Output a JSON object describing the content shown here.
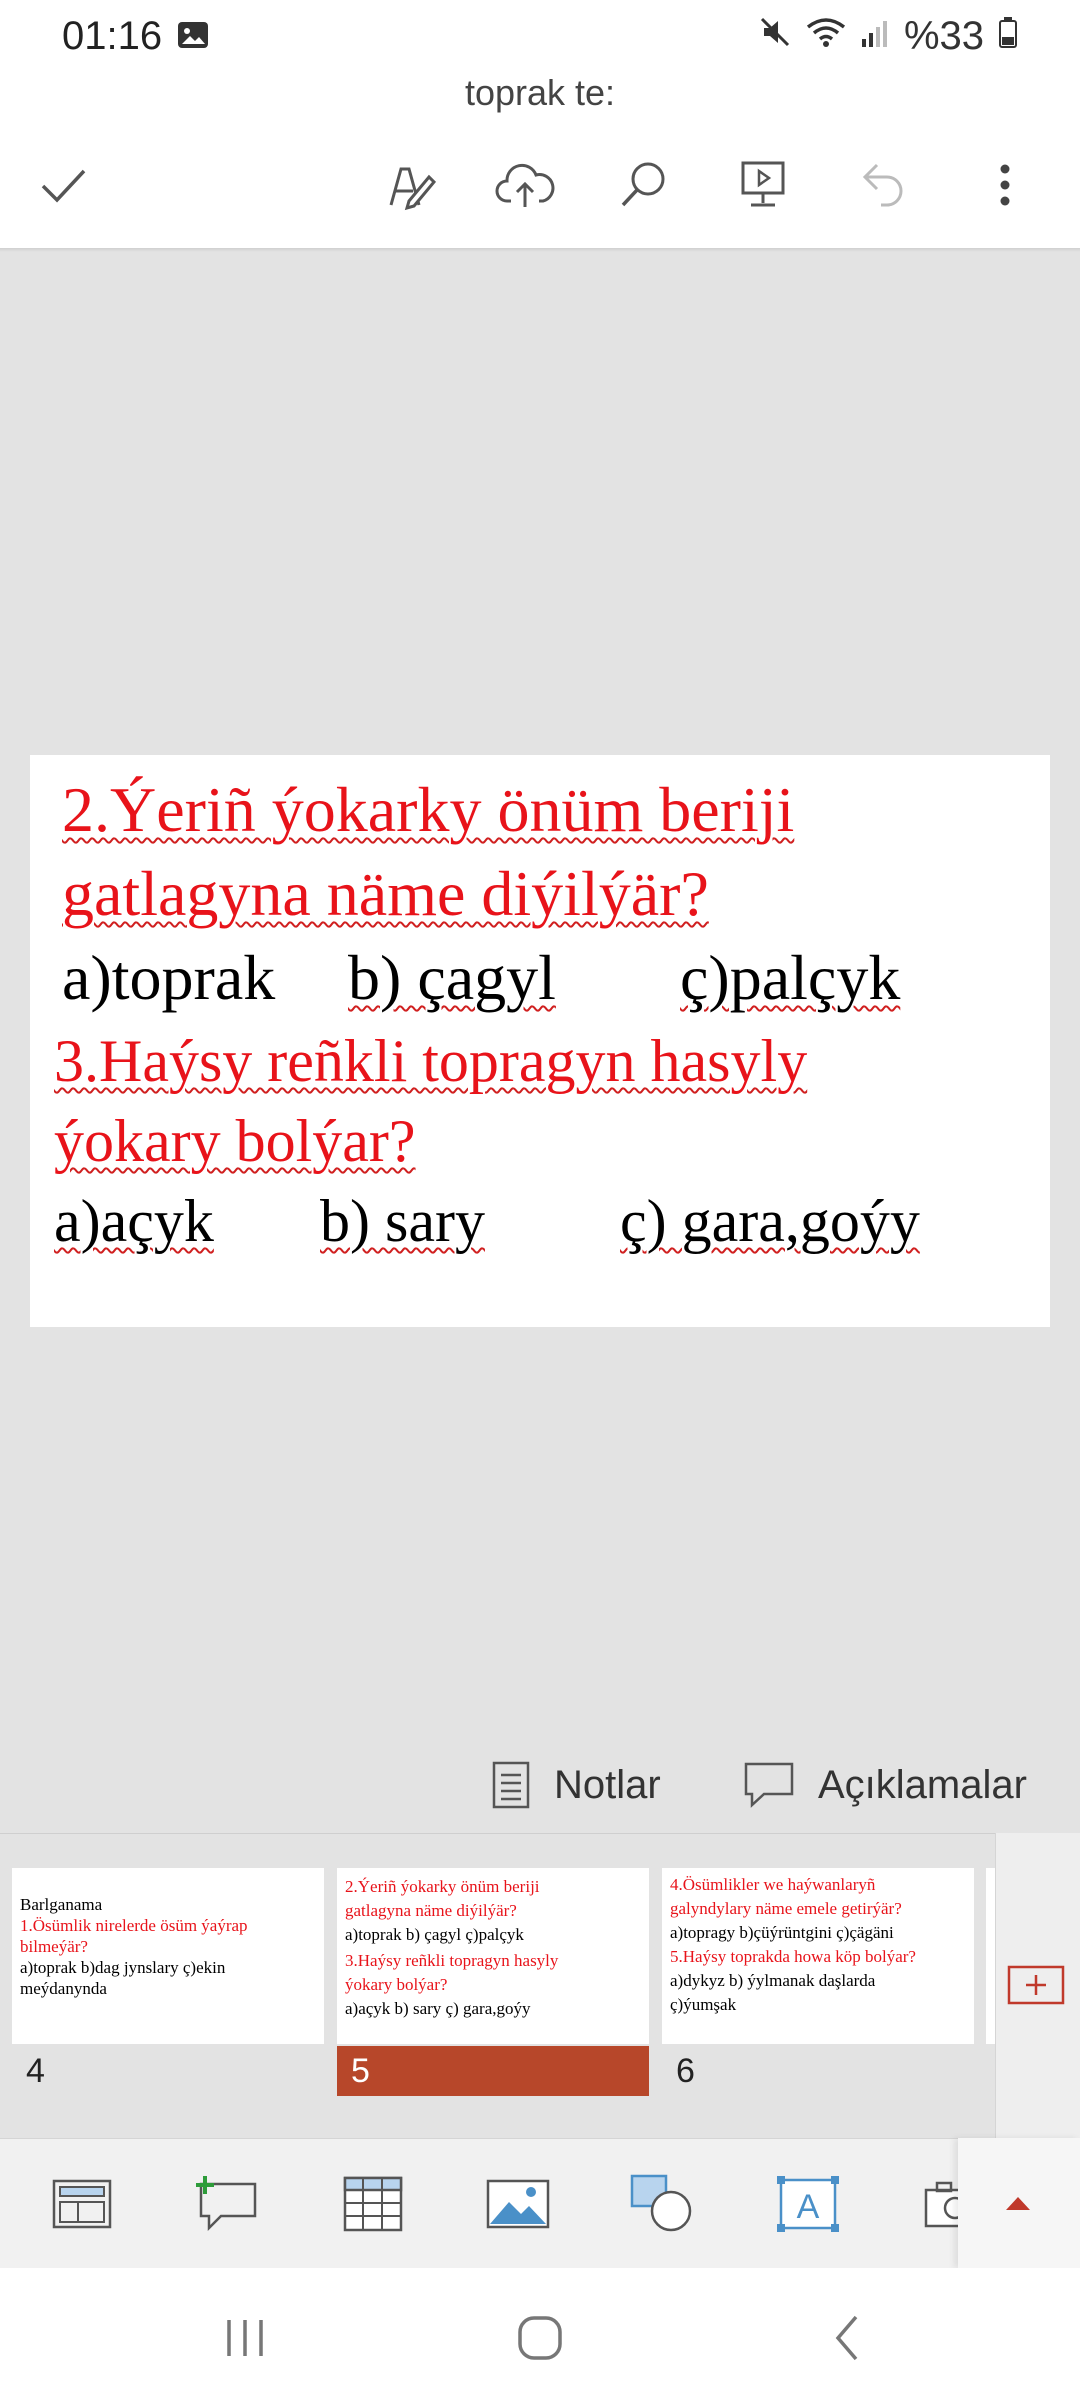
{
  "status": {
    "time": "01:16",
    "battery": "%33"
  },
  "document": {
    "title": "toprak te:"
  },
  "toolbar": {
    "icons": [
      "check-icon",
      "pen-icon",
      "cloud-upload-icon",
      "search-icon",
      "present-icon",
      "undo-icon",
      "more-icon"
    ]
  },
  "slide": {
    "q2_line1": "2.Ýeriñ ýokarky önüm beriji",
    "q2_line2": "gatlagyna näme diýilýär?",
    "q2_opt_a": "a)toprak",
    "q2_opt_b": "b) çagyl",
    "q2_opt_c": "ç)palçyk",
    "q3_line1": "3.Haýsy reñkli topragyn hasyly",
    "q3_line2": "ýokary bolýar?",
    "q3_opt_a": "a)açyk",
    "q3_opt_b": "b) sary",
    "q3_opt_c": "ç) gara,goýy"
  },
  "notes_bar": {
    "notes_label": "Notlar",
    "comments_label": "Açıklamalar"
  },
  "thumbnails": [
    {
      "number": "4",
      "lines": [
        "Barlganama",
        "1.Ösümlik nirelerde ösüm ýaýrap",
        "bilmeýär?",
        "a)toprak   b)dag jynslary     ç)ekin",
        "meýdanynda"
      ]
    },
    {
      "number": "5",
      "lines": [
        "2.Ýeriñ ýokarky önüm beriji",
        "gatlagyna näme diýilýär?",
        "a)toprak   b) çagyl      ç)palçyk",
        "3.Haýsy reñkli topragyn hasyly",
        "ýokary bolýar?",
        "a)açyk      b) sary        ç) gara,goýy"
      ]
    },
    {
      "number": "6",
      "lines": [
        "4.Ösümlikler we haýwanlaryñ",
        "galyndylary näme emele getirýär?",
        "a)topragy     b)çüýrüntgini      ç)çägäni",
        "5.Haýsy toprakda howa köp bolýar?",
        "a)dykyz     b) ýylmanak daşlarda",
        "ç)ýumşak"
      ]
    }
  ],
  "insert_bar": {
    "icons": [
      "layout-icon",
      "new-comment-icon",
      "table-icon",
      "picture-icon",
      "shapes-icon",
      "textbox-icon",
      "camera-icon",
      "expand-up-icon"
    ]
  },
  "colors": {
    "accent": "#b7472a",
    "question_red": "#e8131a"
  }
}
